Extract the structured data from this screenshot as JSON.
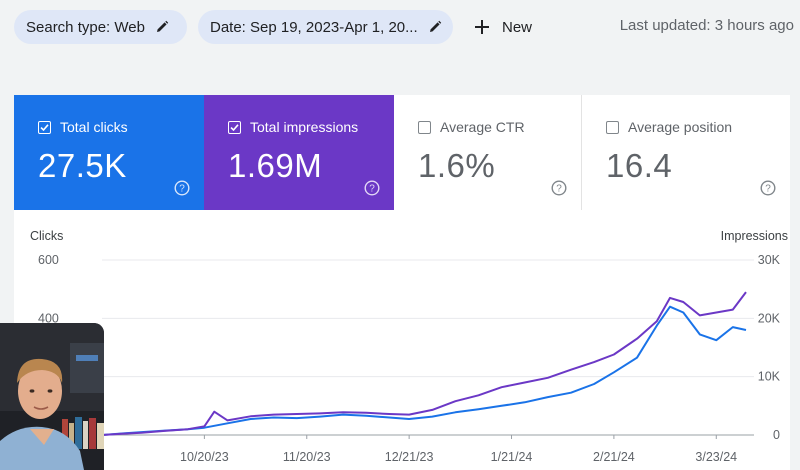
{
  "filters": {
    "search_type": "Search type: Web",
    "date": "Date: Sep 19, 2023-Apr 1, 20..."
  },
  "new_label": "New",
  "last_updated": "Last updated: 3 hours ago",
  "metrics": [
    {
      "label": "Total clicks",
      "value": "27.5K",
      "checked": true,
      "color": "#1a73e8"
    },
    {
      "label": "Total impressions",
      "value": "1.69M",
      "checked": true,
      "color": "#6b38c6"
    },
    {
      "label": "Average CTR",
      "value": "1.6%",
      "checked": false
    },
    {
      "label": "Average position",
      "value": "16.4",
      "checked": false
    }
  ],
  "chart_data": {
    "type": "line",
    "left_axis_title": "Clicks",
    "right_axis_title": "Impressions",
    "left_ticks": [
      "600",
      "400"
    ],
    "right_ticks": [
      "30K",
      "20K",
      "10K",
      "0"
    ],
    "ylim_left": [
      0,
      600
    ],
    "ylim_right": [
      0,
      30000
    ],
    "x_tick_labels": [
      "10/20/23",
      "11/20/23",
      "12/21/23",
      "1/21/24",
      "2/21/24",
      "3/23/24"
    ],
    "series": [
      {
        "name": "Clicks",
        "color": "#1a73e8",
        "axis": "left",
        "points": [
          [
            "2023-09-19",
            0
          ],
          [
            "2023-09-25",
            5
          ],
          [
            "2023-10-01",
            10
          ],
          [
            "2023-10-08",
            15
          ],
          [
            "2023-10-15",
            20
          ],
          [
            "2023-10-20",
            25
          ],
          [
            "2023-10-27",
            40
          ],
          [
            "2023-11-03",
            55
          ],
          [
            "2023-11-10",
            60
          ],
          [
            "2023-11-17",
            58
          ],
          [
            "2023-11-24",
            63
          ],
          [
            "2023-12-01",
            70
          ],
          [
            "2023-12-08",
            66
          ],
          [
            "2023-12-15",
            60
          ],
          [
            "2023-12-21",
            55
          ],
          [
            "2023-12-28",
            63
          ],
          [
            "2024-01-04",
            78
          ],
          [
            "2024-01-11",
            88
          ],
          [
            "2024-01-18",
            100
          ],
          [
            "2024-01-25",
            112
          ],
          [
            "2024-02-01",
            130
          ],
          [
            "2024-02-08",
            145
          ],
          [
            "2024-02-15",
            175
          ],
          [
            "2024-02-21",
            215
          ],
          [
            "2024-02-28",
            265
          ],
          [
            "2024-03-05",
            375
          ],
          [
            "2024-03-09",
            440
          ],
          [
            "2024-03-13",
            420
          ],
          [
            "2024-03-18",
            345
          ],
          [
            "2024-03-23",
            325
          ],
          [
            "2024-03-28",
            370
          ],
          [
            "2024-04-01",
            360
          ]
        ]
      },
      {
        "name": "Impressions",
        "color": "#6b38c6",
        "axis": "right",
        "points": [
          [
            "2023-09-19",
            0
          ],
          [
            "2023-09-25",
            200
          ],
          [
            "2023-10-01",
            400
          ],
          [
            "2023-10-08",
            700
          ],
          [
            "2023-10-15",
            1000
          ],
          [
            "2023-10-20",
            1500
          ],
          [
            "2023-10-23",
            4000
          ],
          [
            "2023-10-27",
            2500
          ],
          [
            "2023-11-03",
            3200
          ],
          [
            "2023-11-10",
            3500
          ],
          [
            "2023-11-17",
            3600
          ],
          [
            "2023-11-24",
            3700
          ],
          [
            "2023-12-01",
            3900
          ],
          [
            "2023-12-08",
            3800
          ],
          [
            "2023-12-15",
            3600
          ],
          [
            "2023-12-21",
            3500
          ],
          [
            "2023-12-28",
            4300
          ],
          [
            "2024-01-04",
            5800
          ],
          [
            "2024-01-11",
            6800
          ],
          [
            "2024-01-18",
            8200
          ],
          [
            "2024-01-25",
            9000
          ],
          [
            "2024-02-01",
            9800
          ],
          [
            "2024-02-08",
            11200
          ],
          [
            "2024-02-15",
            12500
          ],
          [
            "2024-02-21",
            13800
          ],
          [
            "2024-02-28",
            16500
          ],
          [
            "2024-03-05",
            19500
          ],
          [
            "2024-03-09",
            23500
          ],
          [
            "2024-03-13",
            22800
          ],
          [
            "2024-03-18",
            20500
          ],
          [
            "2024-03-23",
            21000
          ],
          [
            "2024-03-28",
            21500
          ],
          [
            "2024-04-01",
            24500
          ]
        ]
      }
    ]
  }
}
